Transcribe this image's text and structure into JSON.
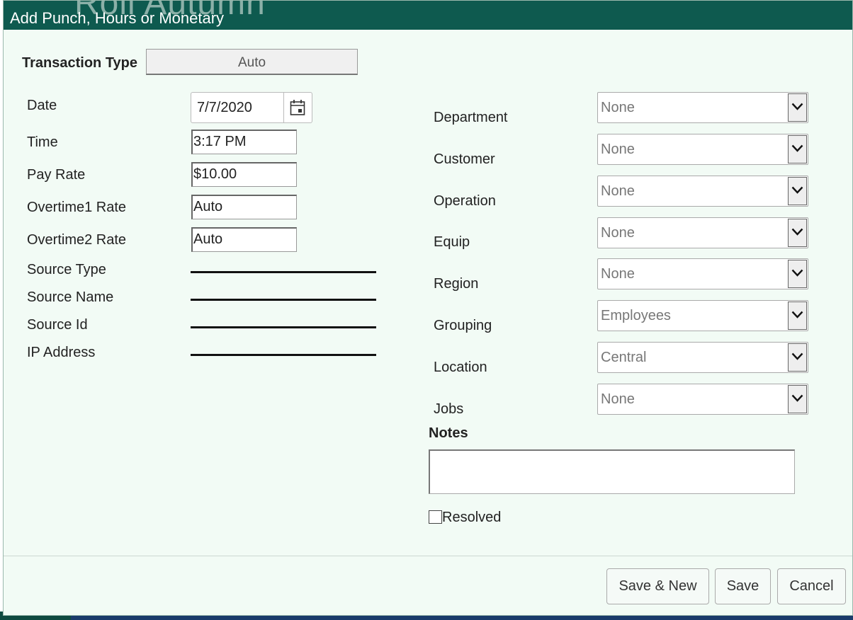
{
  "dialog": {
    "title": "Add Punch, Hours or Monetary",
    "background_title_fragment": "Roll Autumn"
  },
  "transaction_type": {
    "label": "Transaction Type",
    "value": "Auto"
  },
  "left_fields": {
    "date": {
      "label": "Date",
      "value": "7/7/2020"
    },
    "time": {
      "label": "Time",
      "value": "3:17 PM"
    },
    "pay_rate": {
      "label": "Pay Rate",
      "value": "$10.00"
    },
    "overtime1_rate": {
      "label": "Overtime1 Rate",
      "value": "Auto"
    },
    "overtime2_rate": {
      "label": "Overtime2 Rate",
      "value": "Auto"
    },
    "source_type": {
      "label": "Source Type",
      "value": ""
    },
    "source_name": {
      "label": "Source Name",
      "value": ""
    },
    "source_id": {
      "label": "Source Id",
      "value": ""
    },
    "ip_address": {
      "label": "IP Address",
      "value": ""
    }
  },
  "right_fields": {
    "department": {
      "label": "Department",
      "value": "None"
    },
    "customer": {
      "label": "Customer",
      "value": "None"
    },
    "operation": {
      "label": "Operation",
      "value": "None"
    },
    "equip": {
      "label": "Equip",
      "value": "None"
    },
    "region": {
      "label": "Region",
      "value": "None"
    },
    "grouping": {
      "label": "Grouping",
      "value": "Employees"
    },
    "location": {
      "label": "Location",
      "value": "Central"
    },
    "jobs": {
      "label": "Jobs",
      "value": "None"
    }
  },
  "notes": {
    "label": "Notes",
    "value": ""
  },
  "resolved": {
    "label": "Resolved",
    "checked": false
  },
  "footer": {
    "save_new_label": "Save & New",
    "save_label": "Save",
    "cancel_label": "Cancel"
  },
  "icons": {
    "calendar": "calendar-icon",
    "dropdown": "chevron-down-icon"
  },
  "colors": {
    "titlebar": "#0e5a4f",
    "dialog_bg": "#f2fbf5"
  }
}
